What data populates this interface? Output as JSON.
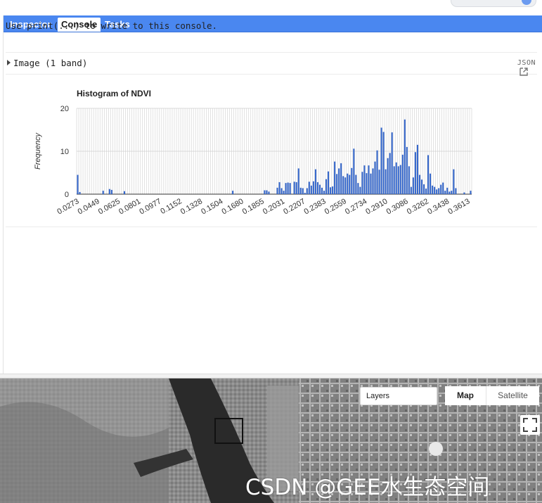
{
  "tabs": [
    {
      "label": "Inspector",
      "active": false
    },
    {
      "label": "Console",
      "active": true
    },
    {
      "label": "Tasks",
      "active": false
    }
  ],
  "console": {
    "hint": "Use print(...) to write to this console.",
    "image_item": "Image (1 band)",
    "json_badge": "JSON"
  },
  "icons": [
    "expand-caret-icon",
    "popout-icon",
    "fullscreen-icon"
  ],
  "chart_data": {
    "type": "bar",
    "title": "Histogram of NDVI",
    "xlabel": "",
    "ylabel": "Frequency",
    "ylim": [
      0,
      20
    ],
    "yticks": [
      0,
      10,
      20
    ],
    "grid": true,
    "bar_color": "#3366cc",
    "xticks": [
      "0.0273",
      "0.0449",
      "0.0625",
      "0.0801",
      "0.0977",
      "0.1152",
      "0.1328",
      "0.1504",
      "0.1680",
      "0.1855",
      "0.2031",
      "0.2207",
      "0.2383",
      "0.2559",
      "0.2734",
      "0.2910",
      "0.3086",
      "0.3262",
      "0.3438",
      "0.3613"
    ],
    "values": [
      4.5,
      0.5,
      0,
      0,
      0,
      0,
      0,
      0,
      0,
      0,
      0,
      0,
      0.8,
      0,
      0,
      1.2,
      1,
      0,
      0,
      0,
      0,
      0,
      0.7,
      0,
      0,
      0,
      0,
      0,
      0,
      0,
      0,
      0,
      0,
      0,
      0,
      0,
      0,
      0,
      0,
      0,
      0,
      0,
      0,
      0,
      0,
      0,
      0,
      0,
      0,
      0,
      0,
      0,
      0,
      0,
      0,
      0,
      0,
      0,
      0,
      0,
      0,
      0,
      0,
      0,
      0,
      0,
      0,
      0,
      0,
      0,
      0,
      0,
      0,
      0.8,
      0,
      0,
      0,
      0,
      0,
      0,
      0,
      0,
      0,
      0,
      0,
      0,
      0,
      0,
      0.9,
      0.9,
      0.6,
      0,
      0,
      0,
      1.5,
      2.8,
      1.4,
      0.8,
      2.6,
      2.7,
      2.6,
      0,
      2.9,
      2.8,
      6,
      1.5,
      1.4,
      0.3,
      1.4,
      2.9,
      2.0,
      3.0,
      5.8,
      2.8,
      2.2,
      1.5,
      0.8,
      3.5,
      5.3,
      1.6,
      1.8,
      7.6,
      4.7,
      6.0,
      7.2,
      4.2,
      3.9,
      4.8,
      4.5,
      6.1,
      10.6,
      4.5,
      2.6,
      1.7,
      5.2,
      6.7,
      4.9,
      6.7,
      4.8,
      6.0,
      7.6,
      10.2,
      5.7,
      15.5,
      14.5,
      5.8,
      8.4,
      9.6,
      14.4,
      6.5,
      7.4,
      6.5,
      6.8,
      9.2,
      17.4,
      11.0,
      6.5,
      1.7,
      3.9,
      9.8,
      11.5,
      4.5,
      3.4,
      2.3,
      1.3,
      9.1,
      4.8,
      2.0,
      1.7,
      1.1,
      1.4,
      2.2,
      2.7,
      0.8,
      1.5,
      0.6,
      0.8,
      5.8,
      1.4,
      0,
      0,
      0,
      0.4,
      0,
      0,
      0.8
    ]
  },
  "map": {
    "layers_label": "Layers",
    "map_button": "Map",
    "satellite_button": "Satellite",
    "watermark": "CSDN @GEE水生态空间"
  }
}
